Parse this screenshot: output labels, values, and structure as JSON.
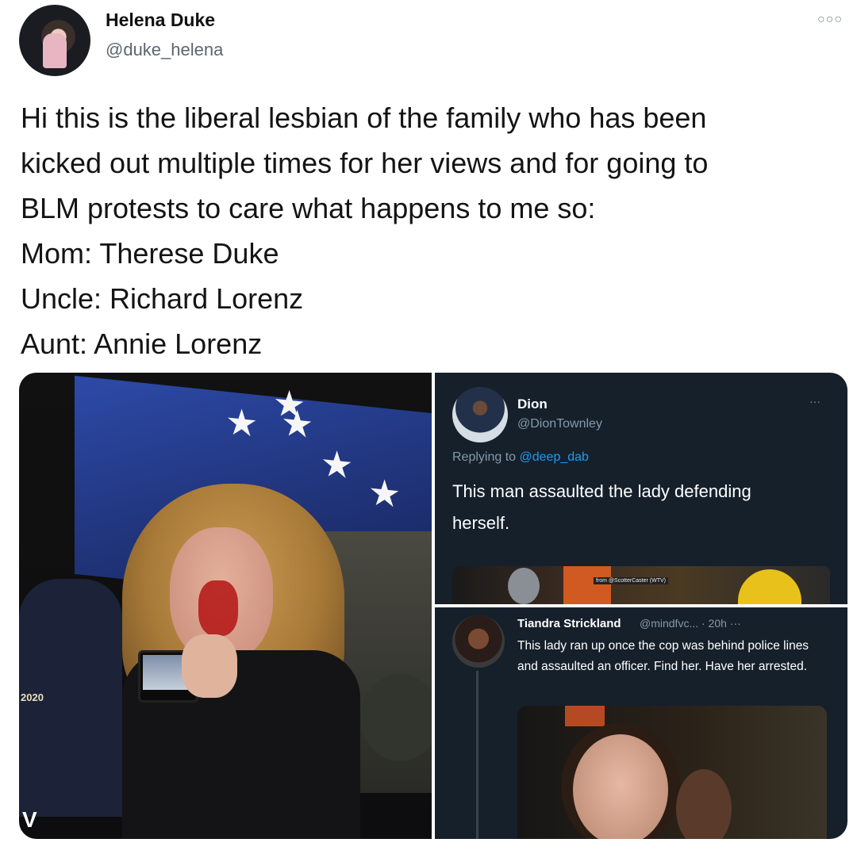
{
  "tweet": {
    "author_name": "Helena Duke",
    "author_handle": "@duke_helena",
    "more_icon": "more-horizontal-icon",
    "text_lines": [
      "Hi this is the liberal lesbian of the family who has been",
      "kicked out multiple times for her views and for going to",
      "BLM protests to care what happens to me so:",
      "Mom: Therese Duke",
      "Uncle: Richard Lorenz",
      "Aunt: Annie Lorenz"
    ]
  },
  "media": {
    "left_photo": {
      "cap_text": "2020",
      "watermark": "V"
    },
    "dion_tweet": {
      "name": "Dion",
      "handle": "@DionTownley",
      "replying_prefix": "Replying to ",
      "replying_handle": "@deep_dab",
      "text": "This man assaulted the lady defending herself.",
      "video_caption": "from @ScotterCaster (WTV)"
    },
    "tiandra_tweet": {
      "name": "Tiandra Strickland",
      "meta": "@mindfvc... · 20h ···",
      "text": "This lady ran up once the cop was behind police lines and assaulted an officer. Find her. Have her arrested."
    }
  },
  "colors": {
    "dark_bg": "#15202b",
    "link": "#1d9bf0",
    "muted": "#8899a6"
  }
}
